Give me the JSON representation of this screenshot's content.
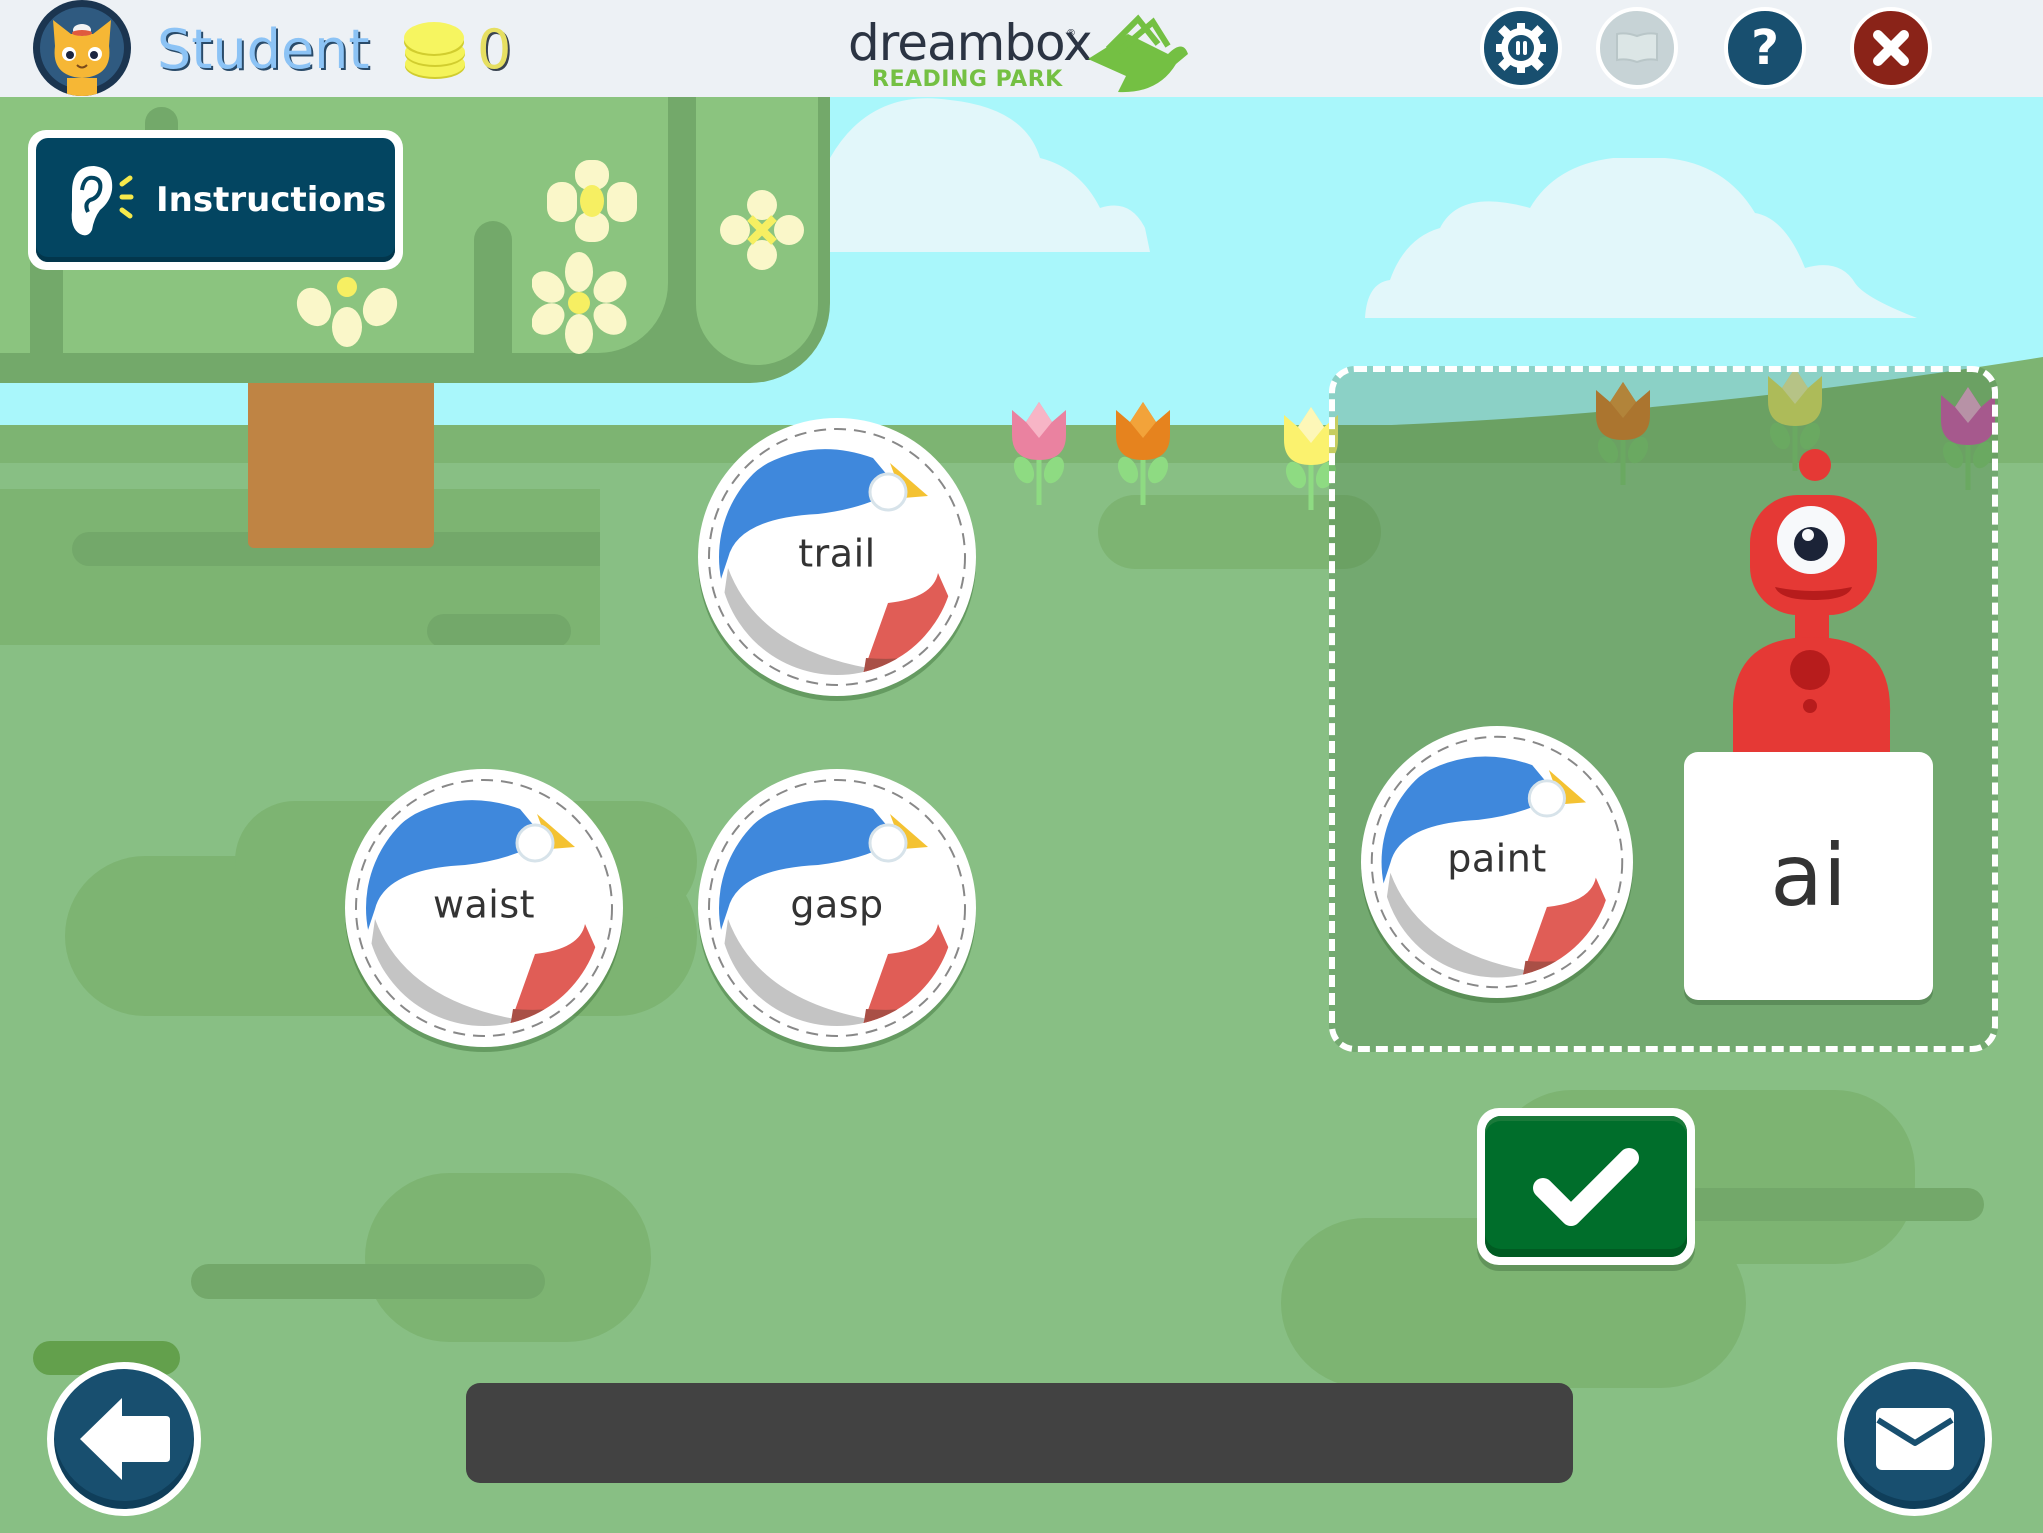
{
  "header": {
    "username": "Student",
    "coins": "0",
    "logo": {
      "brand": "dreambox",
      "registered": "®",
      "product": "READING PARK"
    },
    "buttons": [
      {
        "name": "pause-settings-button",
        "icon": "gear-pause-icon",
        "enabled": true
      },
      {
        "name": "book-button",
        "icon": "book-icon",
        "enabled": false
      },
      {
        "name": "help-button",
        "icon": "question-icon",
        "enabled": true
      },
      {
        "name": "close-button",
        "icon": "close-icon",
        "enabled": true
      }
    ]
  },
  "instructions": {
    "label": "Instructions",
    "icon": "ear-icon"
  },
  "words": {
    "available": [
      "trail",
      "waist",
      "gasp"
    ],
    "placed": "paint"
  },
  "target": {
    "letters": "ai"
  },
  "controls": {
    "check_icon": "checkmark-icon",
    "back_icon": "arrow-left-icon",
    "mail_icon": "envelope-icon"
  },
  "colors": {
    "header_bg": "#edf1f5",
    "username": "#8cc3f5",
    "button_blue": "#184f6f",
    "close_red": "#8a2318",
    "check_green": "#006e2b",
    "instructions_bg": "#034561",
    "ground": "#88bf84",
    "sky": "#a9f7fb",
    "monster": "#e53935"
  }
}
